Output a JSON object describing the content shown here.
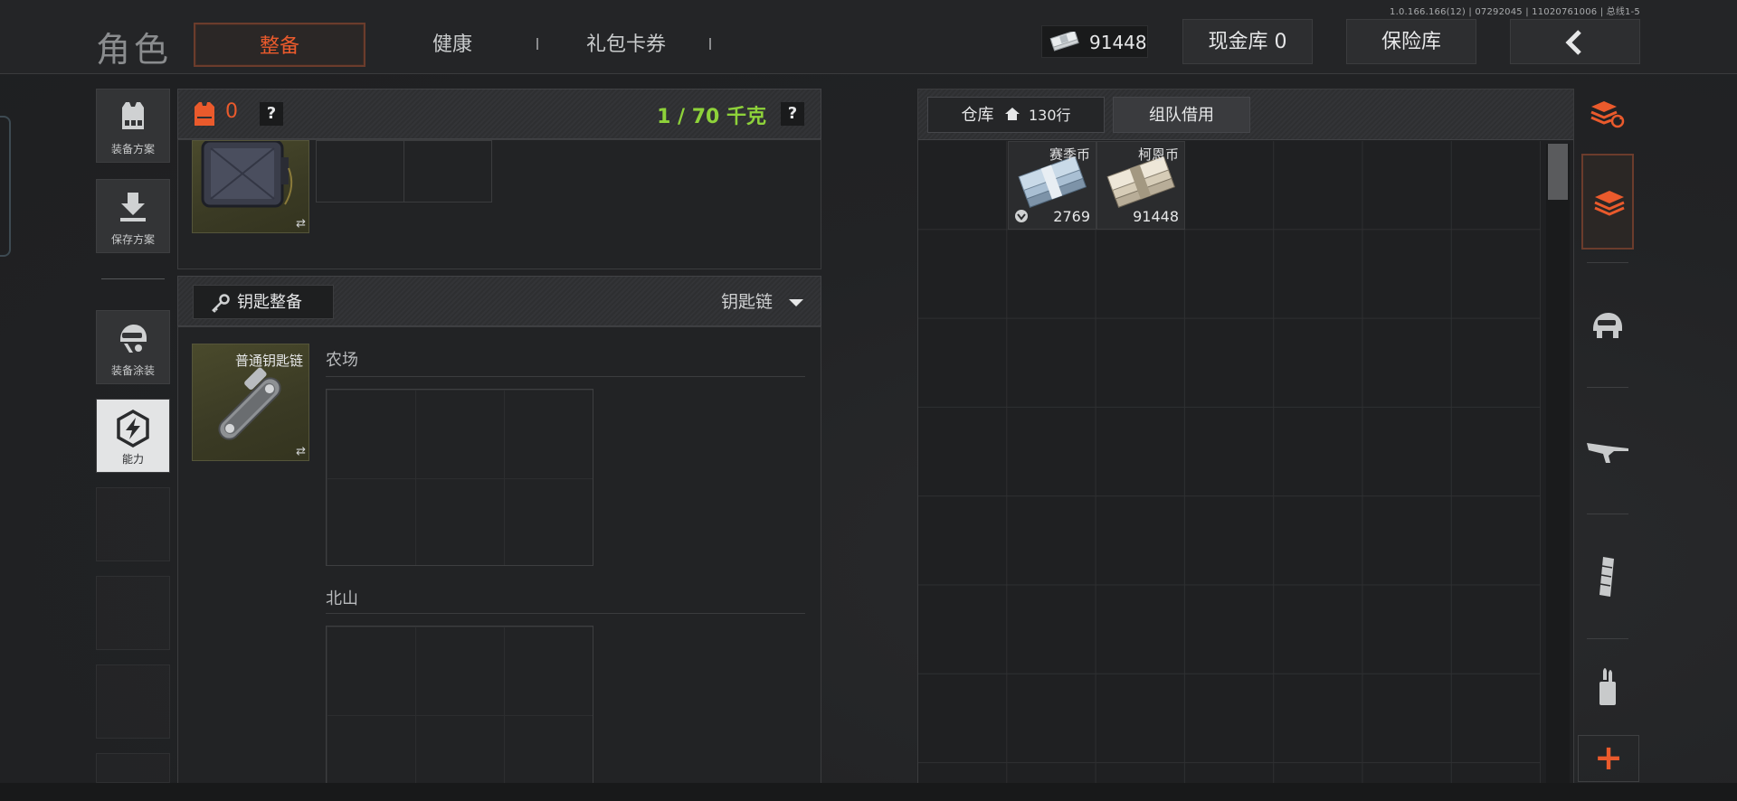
{
  "header": {
    "version": "1.0.166.166(12) | 07292045 | 11020761006 | 总线1-5",
    "page_title": "角色",
    "tabs": [
      {
        "label": "整备",
        "active": true
      },
      {
        "label": "健康",
        "active": false
      },
      {
        "label": "礼包卡券",
        "active": false
      }
    ],
    "currency_amount": "91448",
    "cash_vault_label": "现金库 0",
    "safe_label": "保险库",
    "back_icon": "chevron-left-icon"
  },
  "sidebar": {
    "items": [
      {
        "label": "装备方案",
        "icon": "vest-icon",
        "active": false
      },
      {
        "label": "保存方案",
        "icon": "download-icon",
        "active": false
      },
      {
        "label": "装备涂装",
        "icon": "helmet-paint-icon",
        "active": false
      },
      {
        "label": "能力",
        "icon": "lightning-hex-icon",
        "active": true
      }
    ]
  },
  "capacity": {
    "armor_count": "0",
    "help_label": "?",
    "weight": "1 / 70 千克"
  },
  "keys": {
    "title": "钥匙整备",
    "dropdown_label": "钥匙链",
    "keychain_name": "普通钥匙链",
    "sections": [
      {
        "label": "农场"
      },
      {
        "label": "北山"
      }
    ]
  },
  "warehouse": {
    "tabs": [
      {
        "label": "仓库",
        "suffix": "130行",
        "active": true
      },
      {
        "label": "组队借用",
        "active": false
      }
    ],
    "items": [
      {
        "name": "赛季币",
        "quantity": "2769"
      },
      {
        "name": "柯恩币",
        "quantity": "91448"
      }
    ]
  },
  "filters": {
    "items": [
      "stack-refresh-icon",
      "layers-icon",
      "helmet-icon",
      "rifle-icon",
      "magazine-icon",
      "ammo-icon"
    ],
    "add_label": "+"
  },
  "colors": {
    "accent": "#ea5a2c",
    "weight_green": "#8ed23a",
    "background": "#222325"
  }
}
